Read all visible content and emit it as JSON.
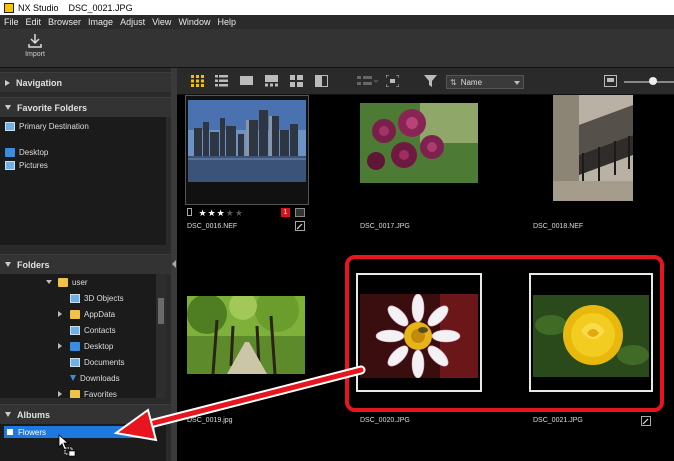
{
  "window": {
    "app_name": "NX Studio",
    "file_name": "DSC_0021.JPG"
  },
  "menu": [
    "File",
    "Edit",
    "Browser",
    "Image",
    "Adjust",
    "View",
    "Window",
    "Help"
  ],
  "toolbar": {
    "import_label": "Import"
  },
  "left_panel": {
    "navigation": "Navigation",
    "favorites": {
      "title": "Favorite Folders",
      "items": [
        "Primary Destination",
        "Desktop",
        "Pictures"
      ]
    },
    "folders": {
      "title": "Folders",
      "items": [
        "user",
        "3D Objects",
        "AppData",
        "Contacts",
        "Desktop",
        "Documents",
        "Downloads",
        "Favorites"
      ]
    },
    "albums": {
      "title": "Albums",
      "items": [
        "Flowers"
      ]
    }
  },
  "main_toolbar": {
    "sort_label": "Name"
  },
  "thumbnails": [
    {
      "file": "DSC_0016.NEF",
      "rating": 3,
      "max_rating": 5,
      "badge": "1"
    },
    {
      "file": "DSC_0017.JPG"
    },
    {
      "file": "DSC_0018.NEF"
    },
    {
      "file": "DSC_0019.jpg"
    },
    {
      "file": "DSC_0020.JPG"
    },
    {
      "file": "DSC_0021.JPG"
    }
  ],
  "colors": {
    "accent_selection": "#1e78e0",
    "highlight_red": "#e8141e",
    "star_active": "#ffffff",
    "star_inactive": "#555555"
  }
}
